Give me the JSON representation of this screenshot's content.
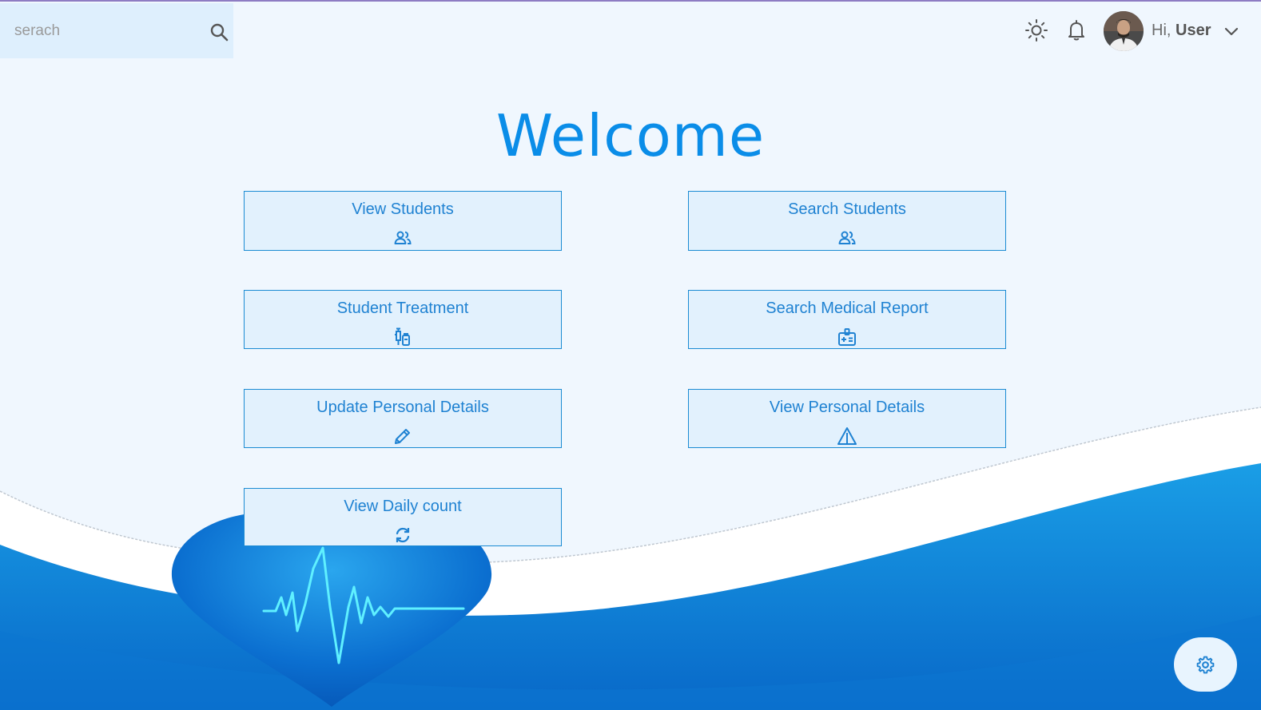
{
  "header": {
    "search_placeholder": "serach",
    "search_icon": "search-icon",
    "theme_icon": "sun-icon",
    "notification_icon": "bell-icon",
    "greeting_prefix": "Hi,",
    "user_name": "User",
    "dropdown_icon": "chevron-down-icon"
  },
  "main": {
    "title": "Welcome"
  },
  "cards": [
    {
      "label": "View Students",
      "icon": "users-icon"
    },
    {
      "label": "Search Students",
      "icon": "users-icon"
    },
    {
      "label": "Student Treatment",
      "icon": "syringe-vial-icon"
    },
    {
      "label": "Search Medical Report",
      "icon": "medical-id-card-icon"
    },
    {
      "label": "Update Personal Details",
      "icon": "pencil-icon"
    },
    {
      "label": "View Personal Details",
      "icon": "warning-triangle-icon"
    },
    {
      "label": "View Daily count",
      "icon": "refresh-icon"
    }
  ],
  "settings_button_icon": "gear-icon",
  "colors": {
    "accent": "#0a8de8",
    "card_border": "#1b8bd3",
    "card_bg": "#e2f1fd",
    "page_bg": "#f0f7fe"
  }
}
